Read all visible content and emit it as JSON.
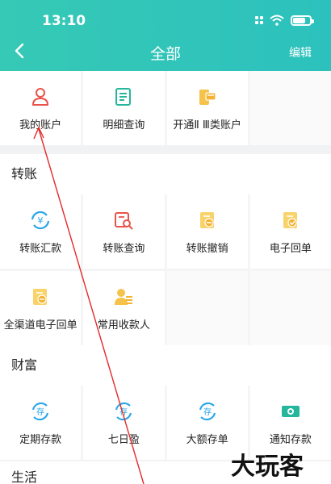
{
  "status": {
    "time": "13:10"
  },
  "nav": {
    "title": "全部",
    "edit": "编辑"
  },
  "sections": {
    "account": {
      "items": [
        {
          "label": "我的账户",
          "icon": "user-icon"
        },
        {
          "label": "明细查询",
          "icon": "document-list-icon"
        },
        {
          "label": "开通Ⅱ Ⅲ类账户",
          "icon": "phone-card-icon"
        }
      ]
    },
    "transfer": {
      "title": "转账",
      "items": [
        {
          "label": "转账汇款",
          "icon": "yuan-exchange-icon"
        },
        {
          "label": "转账查询",
          "icon": "search-document-icon"
        },
        {
          "label": "转账撤销",
          "icon": "receipt-revoke-icon"
        },
        {
          "label": "电子回单",
          "icon": "receipt-icon"
        },
        {
          "label": "全渠道电子回单",
          "icon": "receipt-multi-icon"
        },
        {
          "label": "常用收款人",
          "icon": "payee-icon"
        }
      ]
    },
    "wealth": {
      "title": "财富",
      "items": [
        {
          "label": "定期存款",
          "icon": "deposit-icon"
        },
        {
          "label": "七日盈",
          "icon": "deposit-icon"
        },
        {
          "label": "大额存单",
          "icon": "deposit-icon"
        },
        {
          "label": "通知存款",
          "icon": "cash-icon"
        }
      ]
    },
    "life": {
      "title": "生活"
    }
  },
  "colors": {
    "header": "#2ec4b9",
    "accent_orange": "#f5b233",
    "accent_blue": "#2aa6e8",
    "accent_red": "#e8534a",
    "accent_green": "#25b79b"
  }
}
